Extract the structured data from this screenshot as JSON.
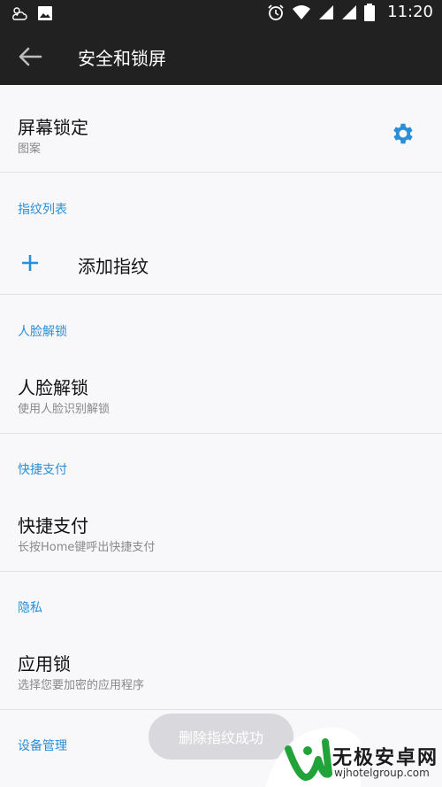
{
  "status_bar": {
    "time": "11:20",
    "icons": [
      "weather-icon",
      "image-icon",
      "alarm-icon",
      "wifi-icon",
      "signal-icon",
      "signal-icon-2",
      "battery-icon"
    ]
  },
  "app_bar": {
    "title": "安全和锁屏",
    "back_icon": "arrow-back-icon"
  },
  "screen_lock": {
    "title": "屏幕锁定",
    "subtitle": "图案",
    "settings_icon": "gear-icon",
    "accent": "#2b8fd6"
  },
  "fingerprint": {
    "category": "指纹列表",
    "add_label": "添加指纹",
    "add_icon": "plus-icon"
  },
  "face_unlock": {
    "category": "人脸解锁",
    "title": "人脸解锁",
    "subtitle": "使用人脸识别解锁"
  },
  "quick_pay": {
    "category": "快捷支付",
    "title": "快捷支付",
    "subtitle": "长按Home键呼出快捷支付"
  },
  "privacy": {
    "category": "隐私",
    "title": "应用锁",
    "subtitle": "选择您要加密的应用程序"
  },
  "device_admin": {
    "category": "设备管理"
  },
  "toast": {
    "message": "删除指纹成功"
  },
  "watermark": {
    "brand": "无极安卓网",
    "url": "wjhotelgroup.com"
  }
}
